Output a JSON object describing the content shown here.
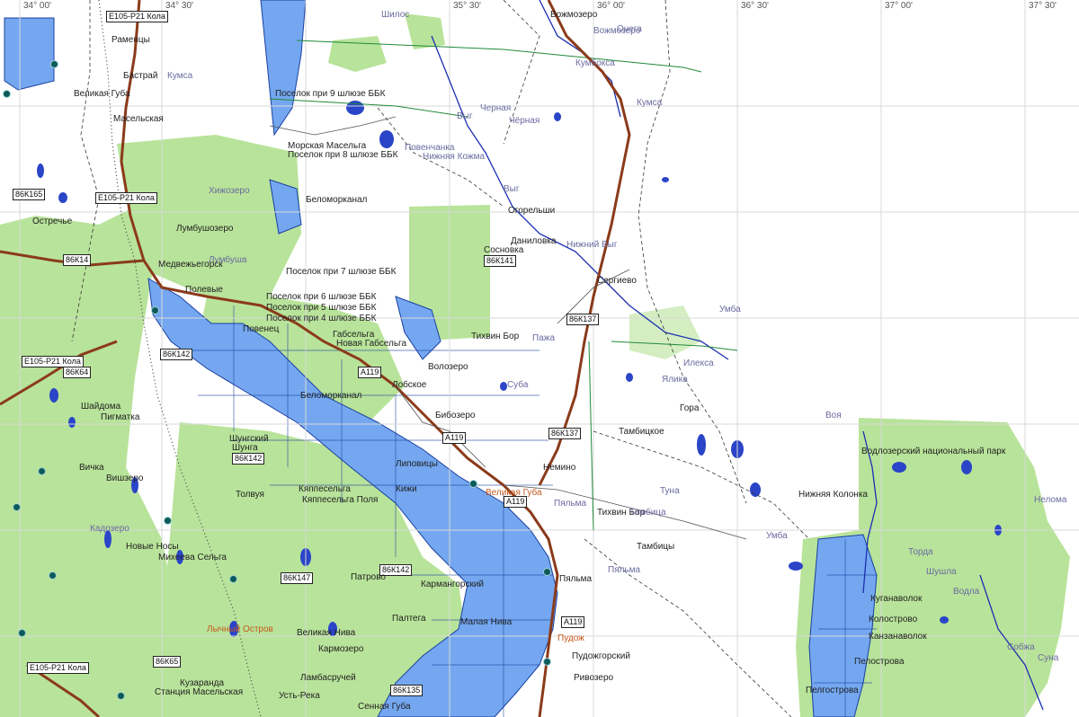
{
  "map": {
    "coord_labels": [
      "34° 00'",
      "34° 30'",
      "35° 30'",
      "36° 00'",
      "36° 30'",
      "37° 00'",
      "37° 30'"
    ],
    "road_labels": [
      "E105-P21 Кола",
      "86К165",
      "E105-P21 Кола",
      "86К14",
      "E105-P21 Кола",
      "86К64",
      "86К142",
      "86К142",
      "86К141",
      "86К137",
      "A119",
      "A119",
      "86К137",
      "A119",
      "86К147",
      "86К142",
      "86К135",
      "86К65",
      "A119",
      "E105-P21 Кола"
    ],
    "settlements": [
      "Вожмозеро",
      "Раменцы",
      "Бастрай",
      "Великая Губа",
      "Масельская",
      "Поселок при 9 шлюзе ББК",
      "Морская Масельга",
      "Поселок при 8 шлюзе ББК",
      "Беломорканал",
      "Хижозеро",
      "Остречье",
      "Лумбушозеро",
      "Медвежьегорск",
      "Полевые",
      "Сосновка",
      "Даниловка",
      "Огорельши",
      "Сергиево",
      "Поселок при 7 шлюзе ББК",
      "Поселок при 6 шлюзе ББК",
      "Поселок при 5 шлюзе ББК",
      "Поселок при 4 шлюзе ББК",
      "Повенец",
      "Габсельга",
      "Новая Габсельга",
      "Тихвин Бор",
      "Волозеро",
      "Бибозеро",
      "Беломорканал",
      "Лобское",
      "Шайдома",
      "Пигматка",
      "Шунгский",
      "Шунга",
      "Вичка",
      "Вишзеро",
      "Кадозеро",
      "Новые Носы",
      "Михеева Сельга",
      "Толвуя",
      "Великая Нива",
      "Патрово",
      "Палтега",
      "Кяппесельга",
      "Кяппесельга Поля",
      "Пудожгорский",
      "Пудож",
      "Пяльма",
      "Немино",
      "Тамбицы",
      "Тамбицкое",
      "Тихвин Бор",
      "Нижняя Колонка",
      "Водлозерский национальный парк",
      "Гора",
      "Куганаволок",
      "Колострово",
      "Канзанаволок",
      "Пелострова",
      "Пелгострова",
      "Ривозеро",
      "Кармангорский",
      "Малая Нива",
      "Великая Губа",
      "Кармозеро",
      "Липовицы",
      "Лычный Остров",
      "Сенная Губа",
      "Ламбасручей",
      "Кузаранда",
      "Усть-Река",
      "Станция Масельская",
      "Кижи"
    ],
    "water_labels": [
      "Шилос",
      "Чёрная",
      "Повенчанка",
      "Выг",
      "Выг",
      "Кумса",
      "Онега",
      "Пажа",
      "Нижний Выг",
      "Воя",
      "Пяльма",
      "Пяльма",
      "Умба",
      "Умба",
      "Туна",
      "Тамбица",
      "Нелома",
      "Водла",
      "Шушла",
      "Торда",
      "Собжа",
      "Суна",
      "Лумбуша",
      "Кумса",
      "Кумбокса",
      "Илекса",
      "Черная",
      "Нижняя Кожма",
      "Суба",
      "Ялика",
      "Вожмозеро"
    ]
  }
}
